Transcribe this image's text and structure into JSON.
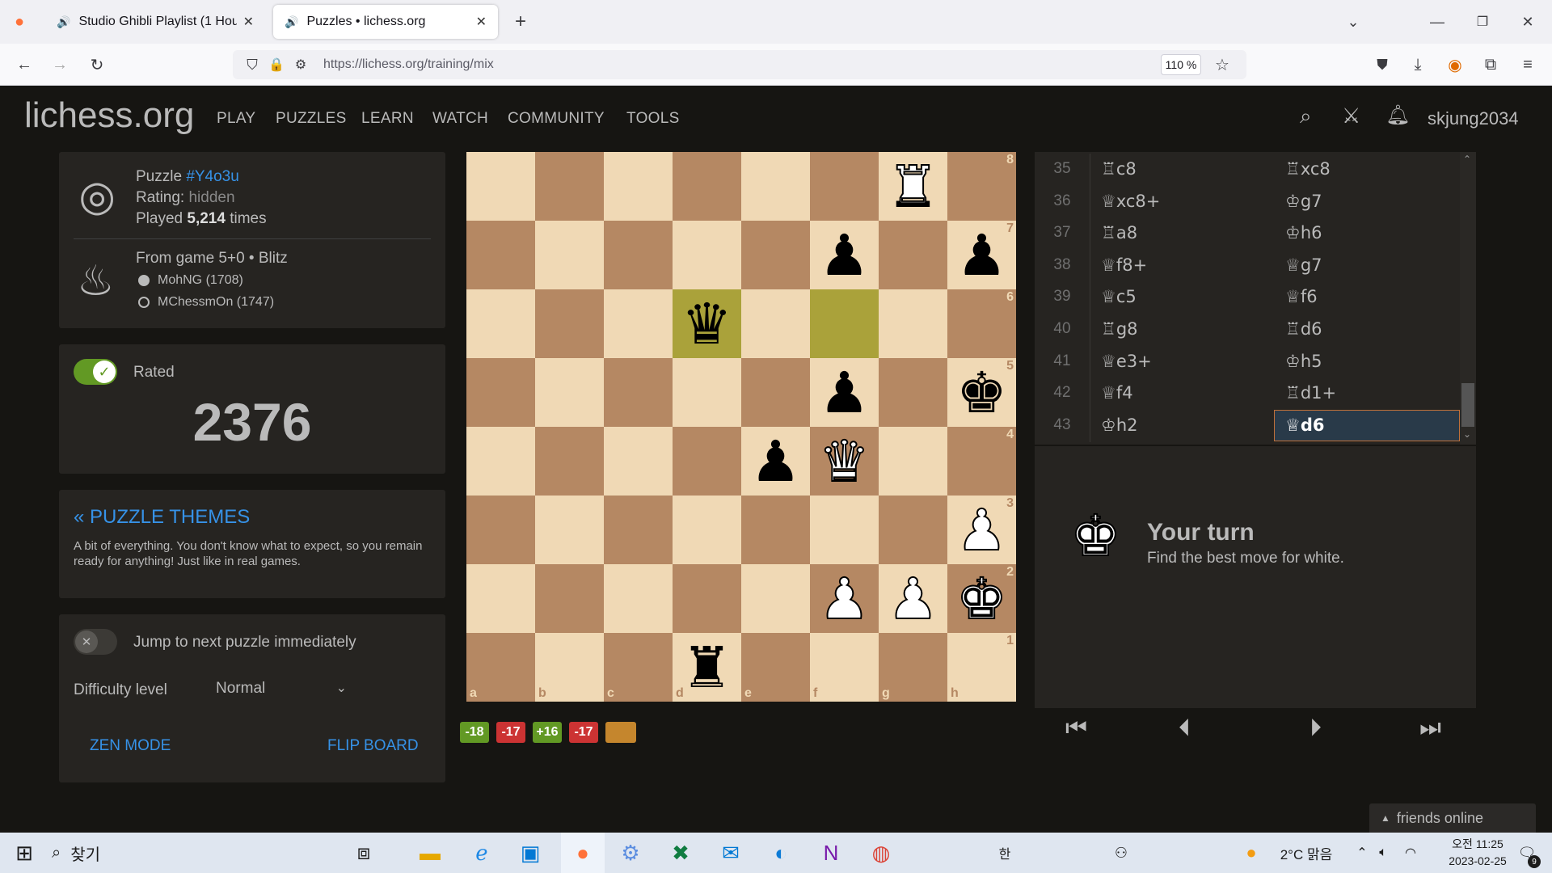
{
  "browser": {
    "tabs": [
      {
        "title": "Studio Ghibli Playlist (1 Hour o",
        "playing": true
      },
      {
        "title": "Puzzles • lichess.org",
        "playing": true
      }
    ],
    "url": "https://lichess.org/training/mix",
    "zoom": "110 %"
  },
  "site": {
    "logo": "lichess.org",
    "nav": [
      "PLAY",
      "PUZZLES",
      "LEARN",
      "WATCH",
      "COMMUNITY",
      "TOOLS"
    ],
    "username": "skjung2034"
  },
  "puzzle": {
    "label": "Puzzle",
    "id": "#Y4o3u",
    "rating_label": "Rating:",
    "rating_value": "hidden",
    "played_prefix": "Played",
    "played_count": "5,214",
    "played_suffix": "times",
    "game": "From game 5+0 • Blitz",
    "white_player": "MohNG (1708)",
    "black_player": "MChessmOn (1747)"
  },
  "rated": {
    "label": "Rated",
    "on": true,
    "rating": "2376"
  },
  "themes": {
    "link": "« PUZZLE THEMES",
    "description": "A bit of everything. You don't know what to expect, so you remain ready for anything! Just like in real games."
  },
  "settings": {
    "jump_label": "Jump to next puzzle immediately",
    "jump_on": false,
    "difficulty_label": "Difficulty level",
    "difficulty_value": "Normal",
    "zen": "ZEN MODE",
    "flip": "FLIP BOARD"
  },
  "board": {
    "ranks": [
      "8",
      "7",
      "6",
      "5",
      "4",
      "3",
      "2",
      "1"
    ],
    "files": [
      "a",
      "b",
      "c",
      "d",
      "e",
      "f",
      "g",
      "h"
    ],
    "highlight": [
      "d6",
      "f6"
    ],
    "pieces": {
      "g8": "wR",
      "f7": "bP",
      "h7": "bP",
      "d6": "bQ",
      "f5": "bP",
      "h5": "bK",
      "e4": "bP",
      "f4": "wQ",
      "h3": "wP",
      "f2": "wP",
      "g2": "wP",
      "h2": "wK",
      "d1": "bR"
    }
  },
  "badges": [
    {
      "text": "-18",
      "color": "#629924"
    },
    {
      "text": "-17",
      "color": "#cc3333"
    },
    {
      "text": "+16",
      "color": "#629924"
    },
    {
      "text": "-17",
      "color": "#cc3333"
    },
    {
      "text": "",
      "color": "#c5862d"
    }
  ],
  "moves": [
    {
      "n": "35",
      "w": "♖c8",
      "b": "♖xc8"
    },
    {
      "n": "36",
      "w": "♕xc8+",
      "b": "♔g7"
    },
    {
      "n": "37",
      "w": "♖a8",
      "b": "♔h6"
    },
    {
      "n": "38",
      "w": "♕f8+",
      "b": "♕g7"
    },
    {
      "n": "39",
      "w": "♕c5",
      "b": "♕f6"
    },
    {
      "n": "40",
      "w": "♖g8",
      "b": "♖d6"
    },
    {
      "n": "41",
      "w": "♕e3+",
      "b": "♔h5"
    },
    {
      "n": "42",
      "w": "♕f4",
      "b": "♖d1+"
    },
    {
      "n": "43",
      "w": "♔h2",
      "b": "♕d6"
    }
  ],
  "turn": {
    "title": "Your turn",
    "subtitle": "Find the best move for white."
  },
  "friends": "friends online",
  "taskbar": {
    "search": "찾기",
    "weather": "2°C 맑음",
    "time": "오전 11:25",
    "date": "2023-02-25",
    "notif": "9",
    "ime": "한"
  },
  "colors": {
    "accent": "#3692e7",
    "bg": "#161512",
    "panel": "#262421",
    "board_light": "#f0d9b5",
    "board_dark": "#b58863",
    "highlight": "#aaa23a"
  }
}
